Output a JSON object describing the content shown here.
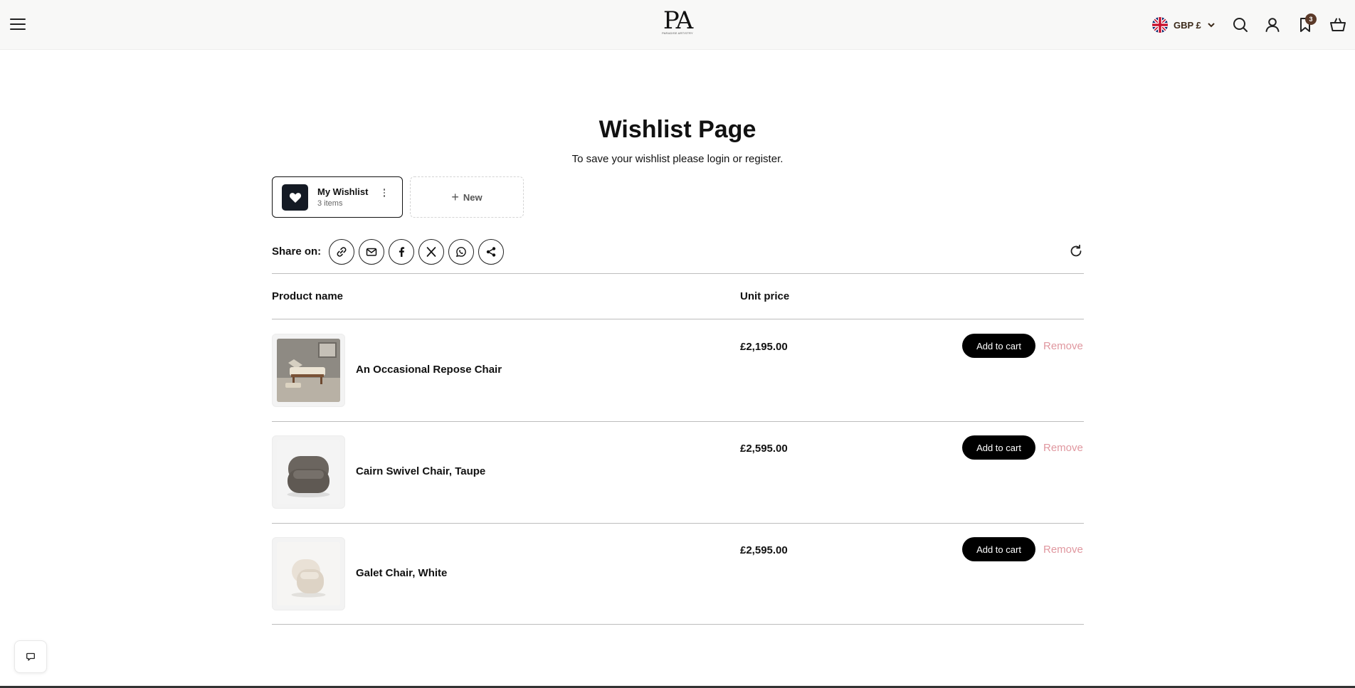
{
  "header": {
    "logo_text": "PA",
    "logo_sub": "PARADISE ARTISTRY",
    "currency": "GBP £",
    "wishlist_count": "3",
    "icons": [
      "menu-icon",
      "uk-flag-icon",
      "chevron-down-icon",
      "search-icon",
      "account-icon",
      "bookmark-icon",
      "basket-icon"
    ]
  },
  "page": {
    "title": "Wishlist Page",
    "subtitle": "To save your wishlist please login or register."
  },
  "wishlists": {
    "active": {
      "name": "My Wishlist",
      "count": "3 items",
      "icon": "heart-icon"
    },
    "new_label": "New"
  },
  "share": {
    "label": "Share on:",
    "buttons": [
      "link-icon",
      "email-icon",
      "facebook-icon",
      "x-icon",
      "whatsapp-icon",
      "share-icon"
    ]
  },
  "table": {
    "headers": {
      "product": "Product name",
      "price": "Unit price"
    },
    "add_label": "Add to cart",
    "remove_label": "Remove",
    "rows": [
      {
        "name": "An Occasional Repose Chair",
        "price": "£2,195.00"
      },
      {
        "name": "Cairn Swivel Chair, Taupe",
        "price": "£2,595.00"
      },
      {
        "name": "Galet Chair, White",
        "price": "£2,595.00"
      }
    ]
  },
  "colors": {
    "header_bg": "#f8f8f7",
    "primary": "#000000",
    "badge": "#5b3a29",
    "remove": "#e0979f"
  }
}
